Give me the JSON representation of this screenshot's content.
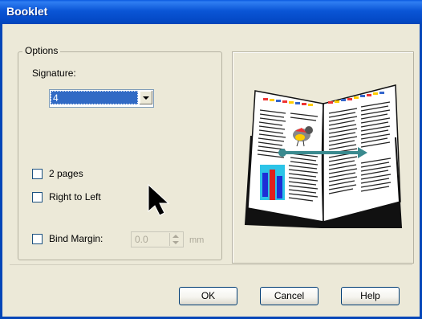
{
  "window": {
    "title": "Booklet"
  },
  "options": {
    "group_label": "Options",
    "signature_label": "Signature:",
    "signature_value": "4",
    "two_pages_label": "2 pages",
    "two_pages_checked": false,
    "right_to_left_label": "Right to Left",
    "right_to_left_checked": false,
    "bind_margin_label": "Bind Margin:",
    "bind_margin_checked": false,
    "bind_margin_value": "0.0",
    "bind_margin_unit": "mm"
  },
  "buttons": {
    "ok": "OK",
    "cancel": "Cancel",
    "help": "Help"
  },
  "colors": {
    "titlebar": "#0a55d6",
    "selection": "#316ac5",
    "face": "#ece9d8",
    "arrow": "#3a8a8f"
  }
}
